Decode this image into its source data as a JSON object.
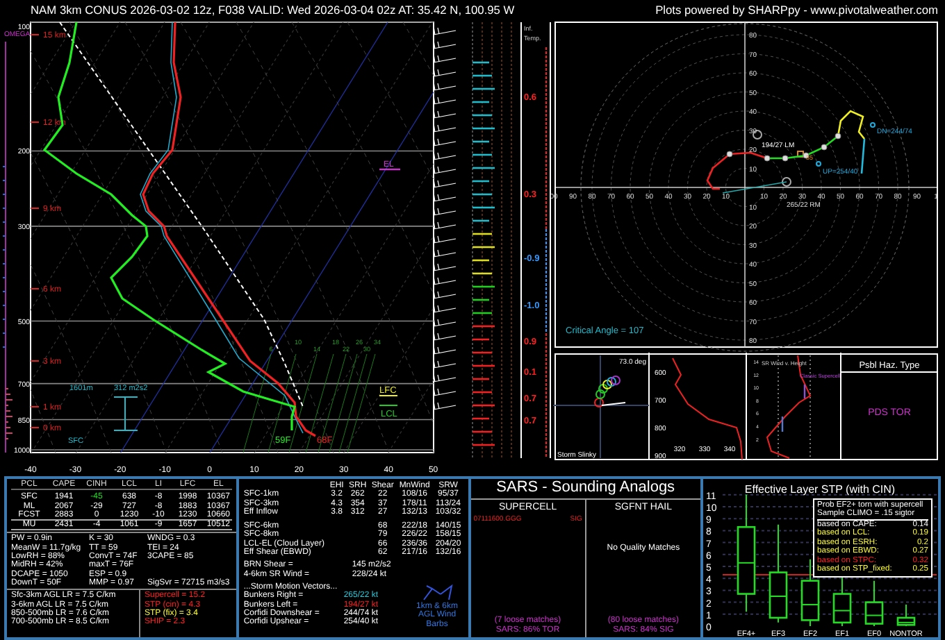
{
  "header": {
    "title": "NAM 3km CONUS 2026-03-02 12z, F038  VALID: Wed 2026-03-04 02z  AT: 35.42 N, 100.95 W",
    "credit": "Plots powered by SHARPpy - www.pivotalweather.com"
  },
  "skewt": {
    "omega_label": "OMEGA",
    "pressure_labels": [
      "100",
      "200",
      "300",
      "500",
      "700",
      "850",
      "1000"
    ],
    "height_labels": [
      "15 km",
      "12 km",
      "9 km",
      "6 km",
      "3 km",
      "1 km",
      "0 km"
    ],
    "temperature_labels": [
      "-40",
      "-30",
      "-20",
      "-10",
      "0",
      "10",
      "20",
      "30",
      "40",
      "50"
    ],
    "mixing_ratio_labels": [
      "6",
      "10",
      "14",
      "18",
      "22",
      "26",
      "30",
      "34"
    ],
    "el_label": "EL",
    "lfc_label": "LFC",
    "lcl_label": "LCL",
    "inflow_depth": "1601m",
    "inflow_srh": "312 m2s2",
    "surface_label": "SFC",
    "dewpoint_reading": "59F",
    "temperature_reading": "68F"
  },
  "inferred_temp": {
    "title": "Inf.",
    "subtitle": "Temp.",
    "values": [
      {
        "text": "0.6",
        "color": "#ff2020"
      },
      {
        "text": "0.3",
        "color": "#ff2020"
      },
      {
        "text": "-0.9",
        "color": "#3399ff"
      },
      {
        "text": "-1.0",
        "color": "#3399ff"
      },
      {
        "text": "0.9",
        "color": "#ff2020"
      },
      {
        "text": "0.1",
        "color": "#ff2020"
      },
      {
        "text": "0.7",
        "color": "#ff2020"
      },
      {
        "text": "0.7",
        "color": "#ff2020"
      }
    ]
  },
  "hodograph": {
    "left_ring_labels": [
      "00",
      "90",
      "80",
      "70",
      "60",
      "50",
      "40",
      "30",
      "20",
      "10"
    ],
    "right_ring_labels": [
      "10",
      "20",
      "30",
      "40",
      "50",
      "60",
      "70",
      "80",
      "90",
      "1"
    ],
    "up_ring_labels": [
      "80",
      "70",
      "60",
      "50",
      "40",
      "30",
      "20",
      "10"
    ],
    "down_ring_labels": [
      "10",
      "20",
      "30",
      "40",
      "50",
      "60",
      "70",
      "80"
    ],
    "left_mover": "194/27 LM",
    "right_mover": "265/22 RM",
    "corfidi_down": "DN=244/74",
    "corfidi_up": "UP=254/40",
    "mean_wind": "35",
    "critical_angle": "Critical Angle = 107"
  },
  "storm_slinky": {
    "angle": "73.0 deg",
    "title": "Storm Slinky"
  },
  "theta_profile": {
    "pressure_labels": [
      "600",
      "700",
      "800",
      "900"
    ],
    "theta_labels": [
      "320",
      "330",
      "340"
    ]
  },
  "sr_wind": {
    "title": "SR Wind v. Height",
    "hazard": "Classic Supercell",
    "height_labels": [
      "14",
      "12",
      "10",
      "8",
      "6",
      "4",
      "2"
    ]
  },
  "hazard_type": {
    "title": "Psbl Haz. Type",
    "value": "PDS TOR"
  },
  "parcels": {
    "columns": [
      "PCL",
      "CAPE",
      "CINH",
      "LCL",
      "LI",
      "LFC",
      "EL"
    ],
    "rows": [
      {
        "cells": [
          "SFC",
          "1941",
          "-45",
          "638",
          "-8",
          "1998",
          "10367"
        ],
        "cinh_highlighted": true,
        "selected": false
      },
      {
        "cells": [
          "ML",
          "2067",
          "-29",
          "727",
          "-8",
          "1883",
          "10367"
        ],
        "cinh_highlighted": false,
        "selected": false
      },
      {
        "cells": [
          "FCST",
          "2883",
          "0",
          "1230",
          "-10",
          "1230",
          "10660"
        ],
        "cinh_highlighted": false,
        "selected": false
      },
      {
        "cells": [
          "MU",
          "2431",
          "-4",
          "1061",
          "-9",
          "1657",
          "10512"
        ],
        "cinh_highlighted": false,
        "selected": true
      }
    ]
  },
  "indices": [
    [
      "PW = 0.9in",
      "K = 30",
      "WNDG = 0.3"
    ],
    [
      "MeanW = 11.7g/kg",
      "TT = 59",
      "TEI = 24"
    ],
    [
      "LowRH = 88%",
      "ConvT = 74F",
      "3CAPE = 85"
    ],
    [
      "MidRH = 42%",
      "maxT = 76F"
    ],
    [
      "DCAPE = 1050",
      "ESP = 0.9"
    ],
    [
      "DownT = 50F",
      "MMP = 0.97",
      "SigSvr = 72715 m3/s3"
    ]
  ],
  "lapse_rates": [
    "Sfc-3km AGL LR = 7.5 C/km",
    "3-6km AGL LR = 7.5 C/km",
    "850-500mb LR = 7.6 C/km",
    "700-500mb LR = 8.5 C/km"
  ],
  "composites": [
    {
      "text": "Supercell = 15.2",
      "color": "#ff2020"
    },
    {
      "text": "STP (cin) = 4.3",
      "color": "#ff2020"
    },
    {
      "text": "STP (fix) = 3.4",
      "color": "#ffff33"
    },
    {
      "text": "SHIP = 2.3",
      "color": "#ff2020"
    }
  ],
  "kinematics": {
    "columns": [
      "EHI",
      "SRH",
      "Shear",
      "MnWind",
      "SRW"
    ],
    "rows": [
      {
        "label": "SFC-1km",
        "values": [
          "3.2",
          "262",
          "22",
          "108/16",
          "95/37"
        ]
      },
      {
        "label": "SFC-3km",
        "values": [
          "4.3",
          "354",
          "37",
          "178/11",
          "113/24"
        ]
      },
      {
        "label": "Eff Inflow",
        "values": [
          "3.8",
          "312",
          "27",
          "132/13",
          "103/32"
        ]
      },
      {
        "label": "SFC-6km",
        "values": [
          "68",
          "222/18",
          "140/15"
        ]
      },
      {
        "label": "SFC-8km",
        "values": [
          "79",
          "226/22",
          "158/15"
        ]
      },
      {
        "label": "LCL-EL (Cloud Layer)",
        "values": [
          "66",
          "236/36",
          "204/20"
        ]
      },
      {
        "label": "Eff Shear (EBWD)",
        "values": [
          "62",
          "217/16",
          "132/16"
        ]
      }
    ]
  },
  "shear_params": [
    {
      "label": "BRN Shear =",
      "value": "145 m2/s2"
    },
    {
      "label": "4-6km SR Wind =",
      "value": "228/24 kt"
    }
  ],
  "storm_motion": {
    "title": "...Storm Motion Vectors...",
    "rows": [
      {
        "label": "Bunkers Right =",
        "value": "265/22 kt",
        "color": "#22ccdd"
      },
      {
        "label": "Bunkers Left =",
        "value": "194/27 kt",
        "color": "#ff2020"
      },
      {
        "label": "Corfidi Downshear =",
        "value": "244/74 kt",
        "color": "#ffffff"
      },
      {
        "label": "Corfidi Upshear =",
        "value": "254/40 kt",
        "color": "#ffffff"
      }
    ]
  },
  "barb_legend": "1km & 6km AGL Wind Barbs",
  "sars": {
    "title": "SARS - Sounding Analogs",
    "supercell": {
      "title": "SUPERCELL",
      "match": "07111600.GGG",
      "match_type": "SIG",
      "loose": "(7 loose matches)",
      "result": "SARS: 86% TOR"
    },
    "hail": {
      "title": "SGFNT HAIL",
      "note": "No Quality Matches",
      "loose": "(80 loose matches)",
      "result": "SARS: 84% SIG"
    }
  },
  "stp": {
    "title": "Effective Layer STP (with CIN)",
    "y_labels": [
      "11",
      "10",
      "9",
      "8",
      "7",
      "6",
      "5",
      "4",
      "3",
      "2",
      "1",
      "0"
    ],
    "categories": [
      "EF4+",
      "EF3",
      "EF2",
      "EF1",
      "EF0",
      "NONTOR"
    ],
    "probability": {
      "title": "Prob EF2+ torn with supercell",
      "climo": "Sample CLIMO = .15 sigtor",
      "rows": [
        {
          "label": "based on CAPE:",
          "value": "0.14",
          "color": "#ffffff"
        },
        {
          "label": "based on LCL:",
          "value": "0.19",
          "color": "#ffff33"
        },
        {
          "label": "based on ESRH:",
          "value": "0.2",
          "color": "#ffff33"
        },
        {
          "label": "based on EBWD:",
          "value": "0.27",
          "color": "#ffff33"
        },
        {
          "label": "based on STPC:",
          "value": "0.32",
          "color": "#ff2020"
        },
        {
          "label": "based on STP_fixed:",
          "value": "0.25",
          "color": "#ffff33"
        }
      ]
    }
  }
}
